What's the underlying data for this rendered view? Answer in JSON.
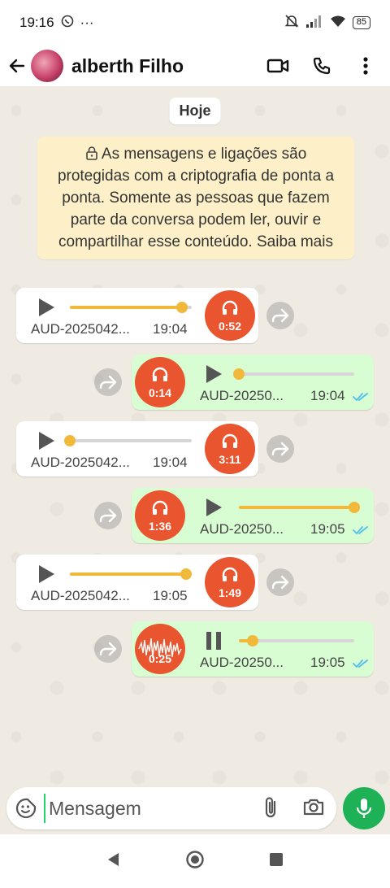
{
  "status_bar": {
    "time": "19:16",
    "dots": "···",
    "battery": "85"
  },
  "header": {
    "contact_name": "alberth Filho"
  },
  "chat": {
    "date_chip": "Hoje",
    "e2e_notice": "As mensagens e ligações são protegidas com a criptografia de ponta a ponta. Somente as pessoas que fazem parte da conversa podem ler, ouvir e compartilhar esse conteúdo. Saiba mais",
    "messages": [
      {
        "direction": "in",
        "filename": "AUD-2025042...",
        "time": "19:04",
        "duration": "0:52",
        "progress": 0.92,
        "state": "paused"
      },
      {
        "direction": "out",
        "filename": "AUD-20250...",
        "time": "19:04",
        "duration": "0:14",
        "progress": 0.0,
        "state": "paused",
        "read": true
      },
      {
        "direction": "in",
        "filename": "AUD-2025042...",
        "time": "19:04",
        "duration": "3:11",
        "progress": 0.0,
        "state": "paused"
      },
      {
        "direction": "out",
        "filename": "AUD-20250...",
        "time": "19:05",
        "duration": "1:36",
        "progress": 1.0,
        "state": "paused",
        "read": true
      },
      {
        "direction": "in",
        "filename": "AUD-2025042...",
        "time": "19:05",
        "duration": "1:49",
        "progress": 0.95,
        "state": "paused"
      },
      {
        "direction": "out",
        "filename": "AUD-20250...",
        "time": "19:05",
        "duration": "0:25",
        "progress": 0.12,
        "state": "playing",
        "read": true
      }
    ]
  },
  "composer": {
    "placeholder": "Mensagem"
  },
  "colors": {
    "accent_green": "#1fb155",
    "outgoing_bubble": "#d9fdd3",
    "audio_badge": "#e9552e",
    "progress": "#f0b93a",
    "read_ticks": "#53bdeb"
  },
  "icons": {
    "back": "arrow-left-icon",
    "video": "video-call-icon",
    "phone": "voice-call-icon",
    "menu": "more-vertical-icon",
    "lock": "lock-icon",
    "play": "play-icon",
    "pause": "pause-icon",
    "headphones": "headphones-icon",
    "forward": "forward-icon",
    "sticker": "sticker-icon",
    "attach": "paperclip-icon",
    "camera": "camera-icon",
    "mic": "microphone-icon"
  }
}
